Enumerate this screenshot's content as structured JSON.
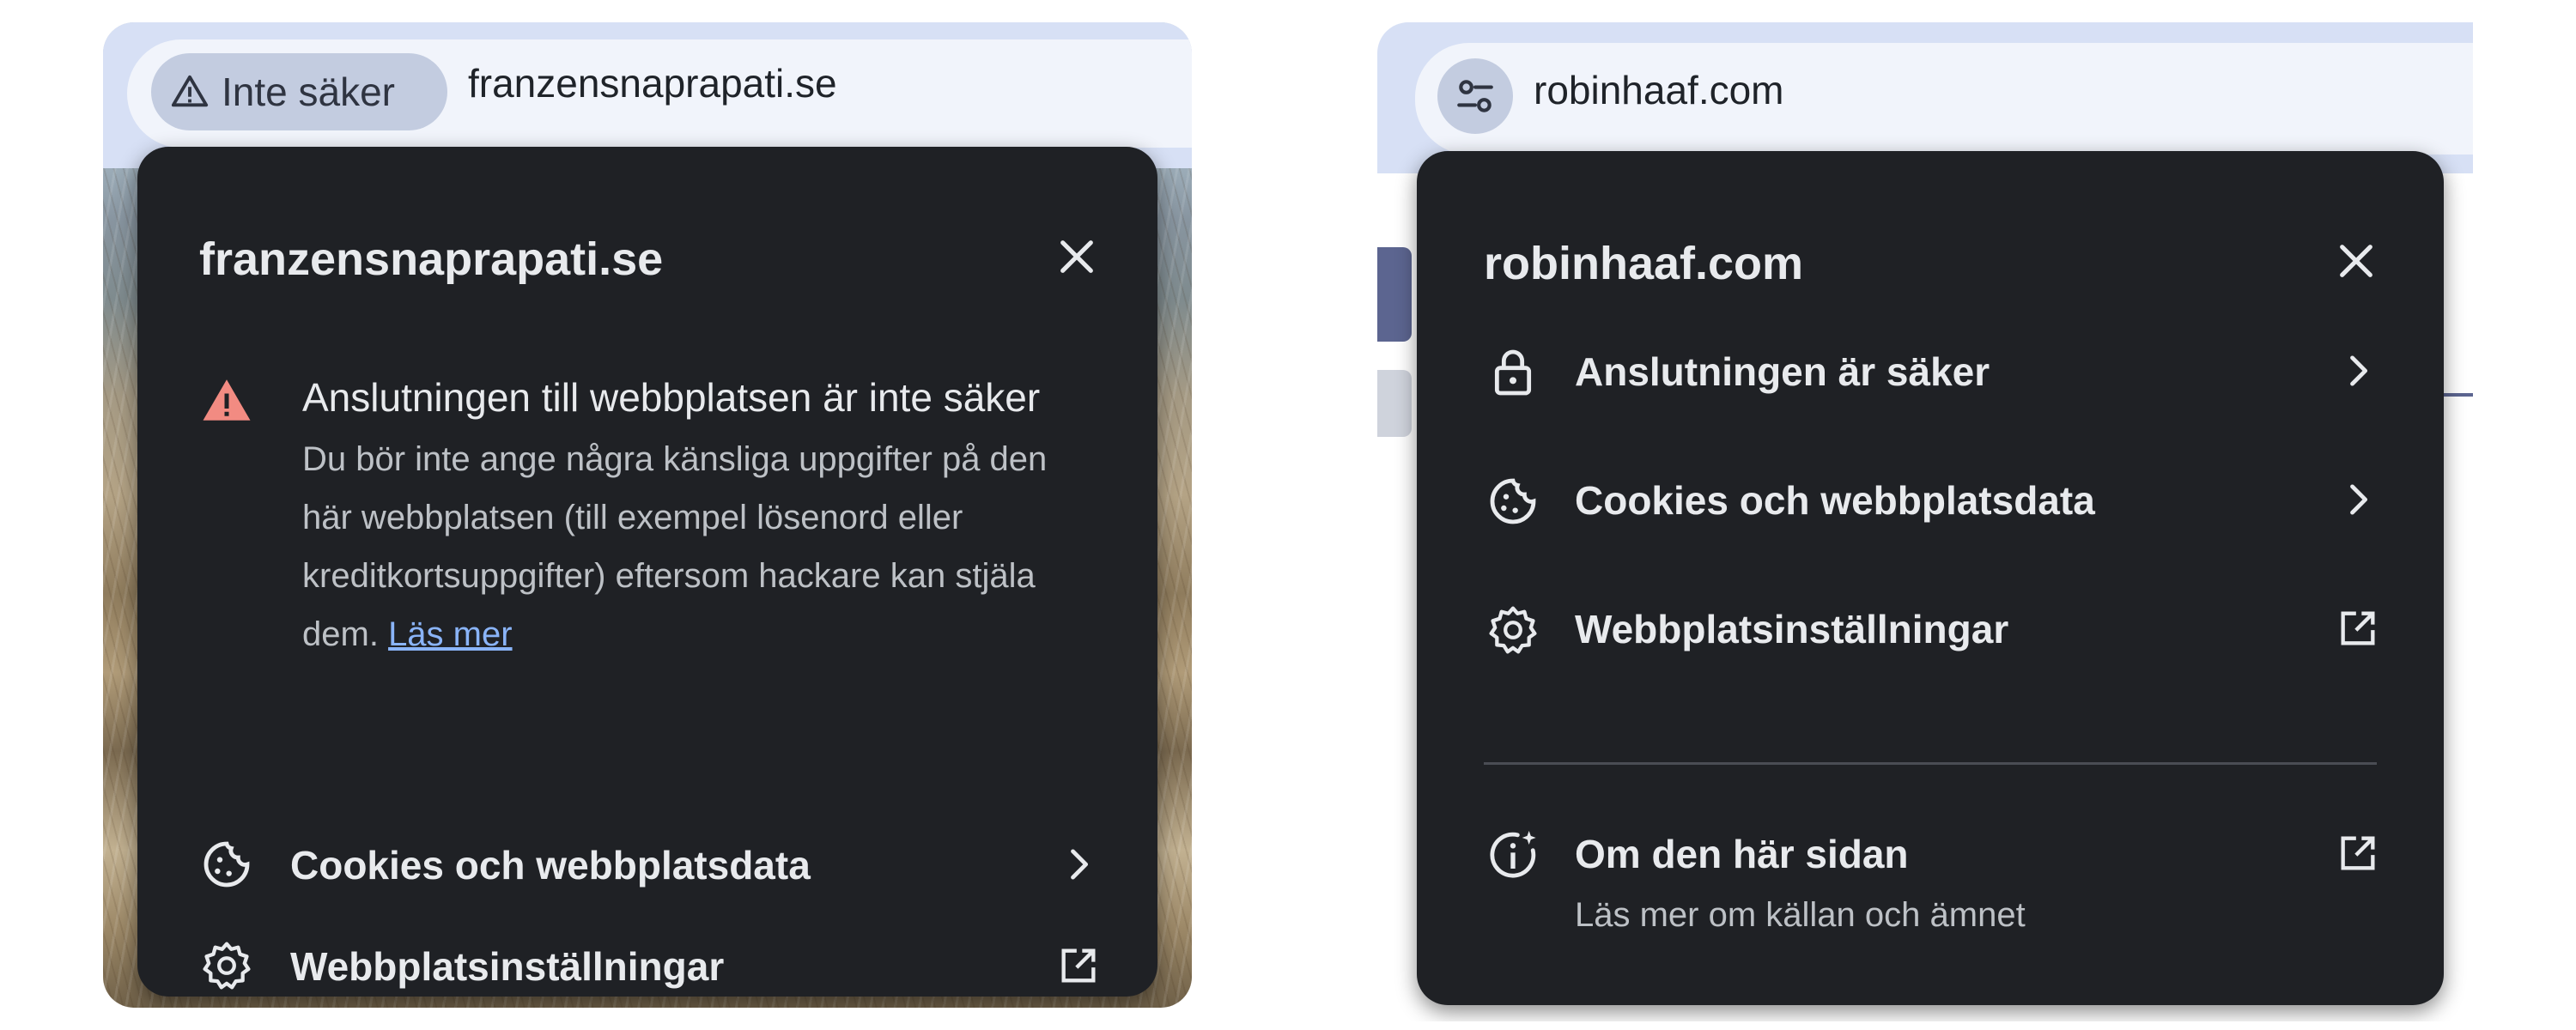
{
  "left": {
    "security_chip_label": "Inte säker",
    "url": "franzensnaprapati.se",
    "popup": {
      "title": "franzensnaprapati.se",
      "warning_title": "Anslutningen till webbplatsen är inte säker",
      "warning_body": "Du bör inte ange några känsliga uppgifter på den här webbplatsen (till exempel lösenord eller kreditkortsuppgifter) eftersom hackare kan stjäla dem.",
      "learn_more": "Läs mer",
      "rows": [
        {
          "label": "Cookies och webbplatsdata",
          "icon": "cookie-icon",
          "end_icon": "chevron-right-icon"
        },
        {
          "label": "Webbplatsinställningar",
          "icon": "gear-icon",
          "end_icon": "open-in-new-icon"
        }
      ]
    }
  },
  "right": {
    "url": "robinhaaf.com",
    "popup": {
      "title": "robinhaaf.com",
      "rows": [
        {
          "label": "Anslutningen är säker",
          "icon": "lock-icon",
          "end_icon": "chevron-right-icon"
        },
        {
          "label": "Cookies och webbplatsdata",
          "icon": "cookie-icon",
          "end_icon": "chevron-right-icon"
        },
        {
          "label": "Webbplatsinställningar",
          "icon": "gear-icon",
          "end_icon": "open-in-new-icon"
        }
      ],
      "about": {
        "label": "Om den här sidan",
        "sublabel": "Läs mer om källan och ämnet",
        "icon": "info-sparkle-icon",
        "end_icon": "open-in-new-icon"
      }
    }
  },
  "colors": {
    "popup_bg": "#1f2125",
    "warning_red": "#f28b82",
    "link_blue": "#8ab4f8",
    "chip_bg": "#c3cce0"
  }
}
